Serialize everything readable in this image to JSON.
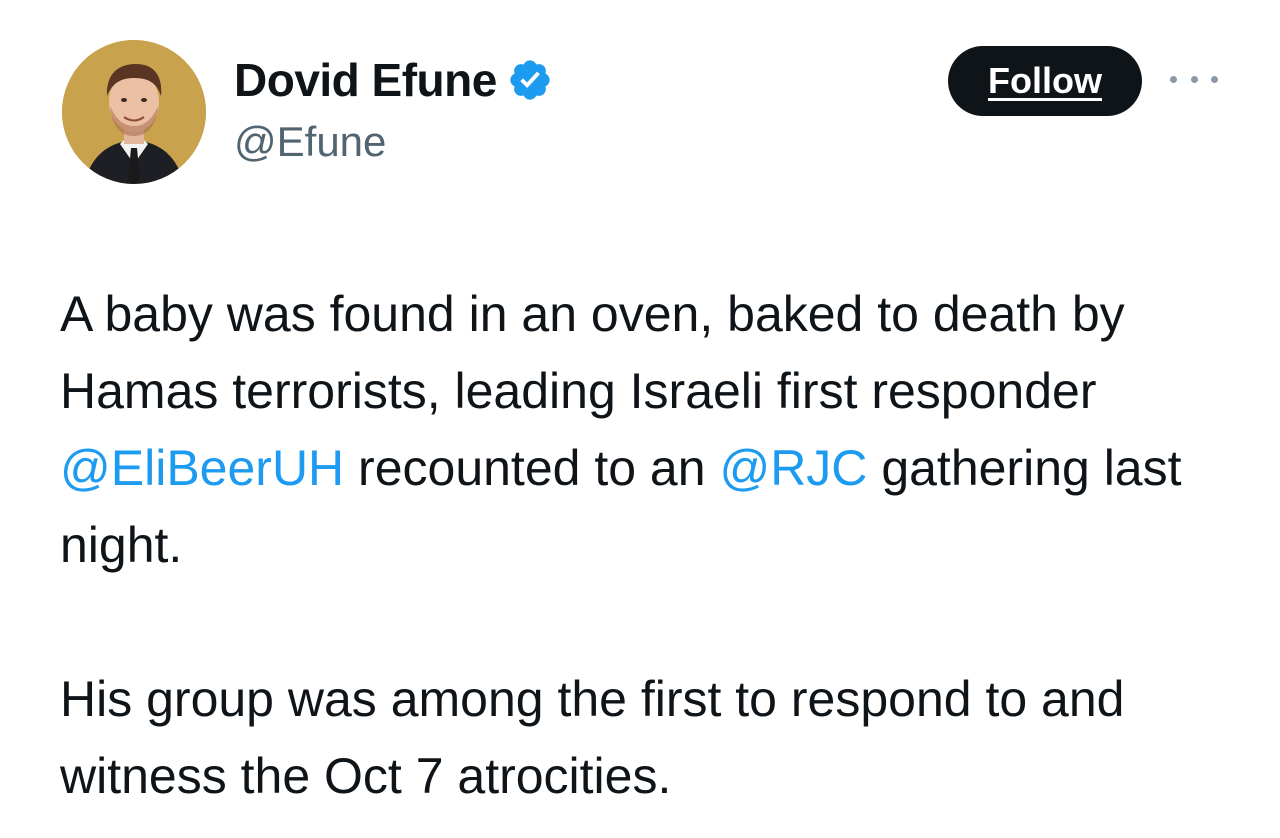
{
  "author": {
    "name": "Dovid Efune",
    "handle": "@Efune",
    "verified": true,
    "verified_icon": "verified-badge-icon",
    "avatar_icon": "profile-photo"
  },
  "actions": {
    "follow_label": "Follow",
    "more_icon": "more-options-icon"
  },
  "tweet": {
    "paragraph1": {
      "part1": "A baby was found in an oven, baked to death by Hamas terrorists, leading Israeli first responder ",
      "mention1": "@EliBeerUH",
      "part2": " recounted to an ",
      "mention2": "@RJC",
      "part3": " gathering last night."
    },
    "paragraph2": "His group was among the first to respond to and witness the Oct 7 atrocities."
  },
  "colors": {
    "text": "#0f1419",
    "secondary": "#536471",
    "link": "#1d9bf0",
    "verified": "#1d9bf0",
    "follow_bg": "#0f1419"
  }
}
